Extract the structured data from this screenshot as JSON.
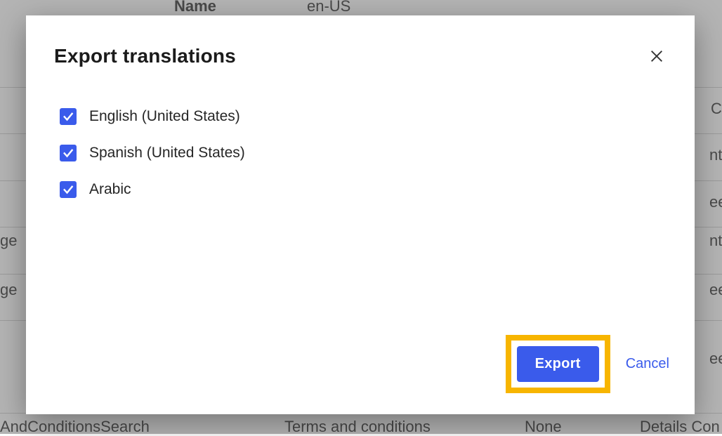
{
  "modal": {
    "title": "Export translations",
    "languages": [
      {
        "label": "English (United States)",
        "checked": true
      },
      {
        "label": "Spanish (United States)",
        "checked": true
      },
      {
        "label": "Arabic",
        "checked": true
      }
    ],
    "export_label": "Export",
    "cancel_label": "Cancel"
  },
  "background": {
    "header_name": "Name",
    "header_en": "en-US",
    "row_frag_left1": "ge",
    "row_frag_left2": "ge",
    "row_frag_co": "Co",
    "row_frag_nt1": "nt",
    "row_frag_ee1": "ee",
    "row_frag_nt2": "nt",
    "row_frag_ee2": "ee",
    "bottom_left": "AndConditionsSearch",
    "bottom_mid": "Terms and conditions",
    "bottom_none": "None",
    "bottom_right": "Details Con"
  }
}
